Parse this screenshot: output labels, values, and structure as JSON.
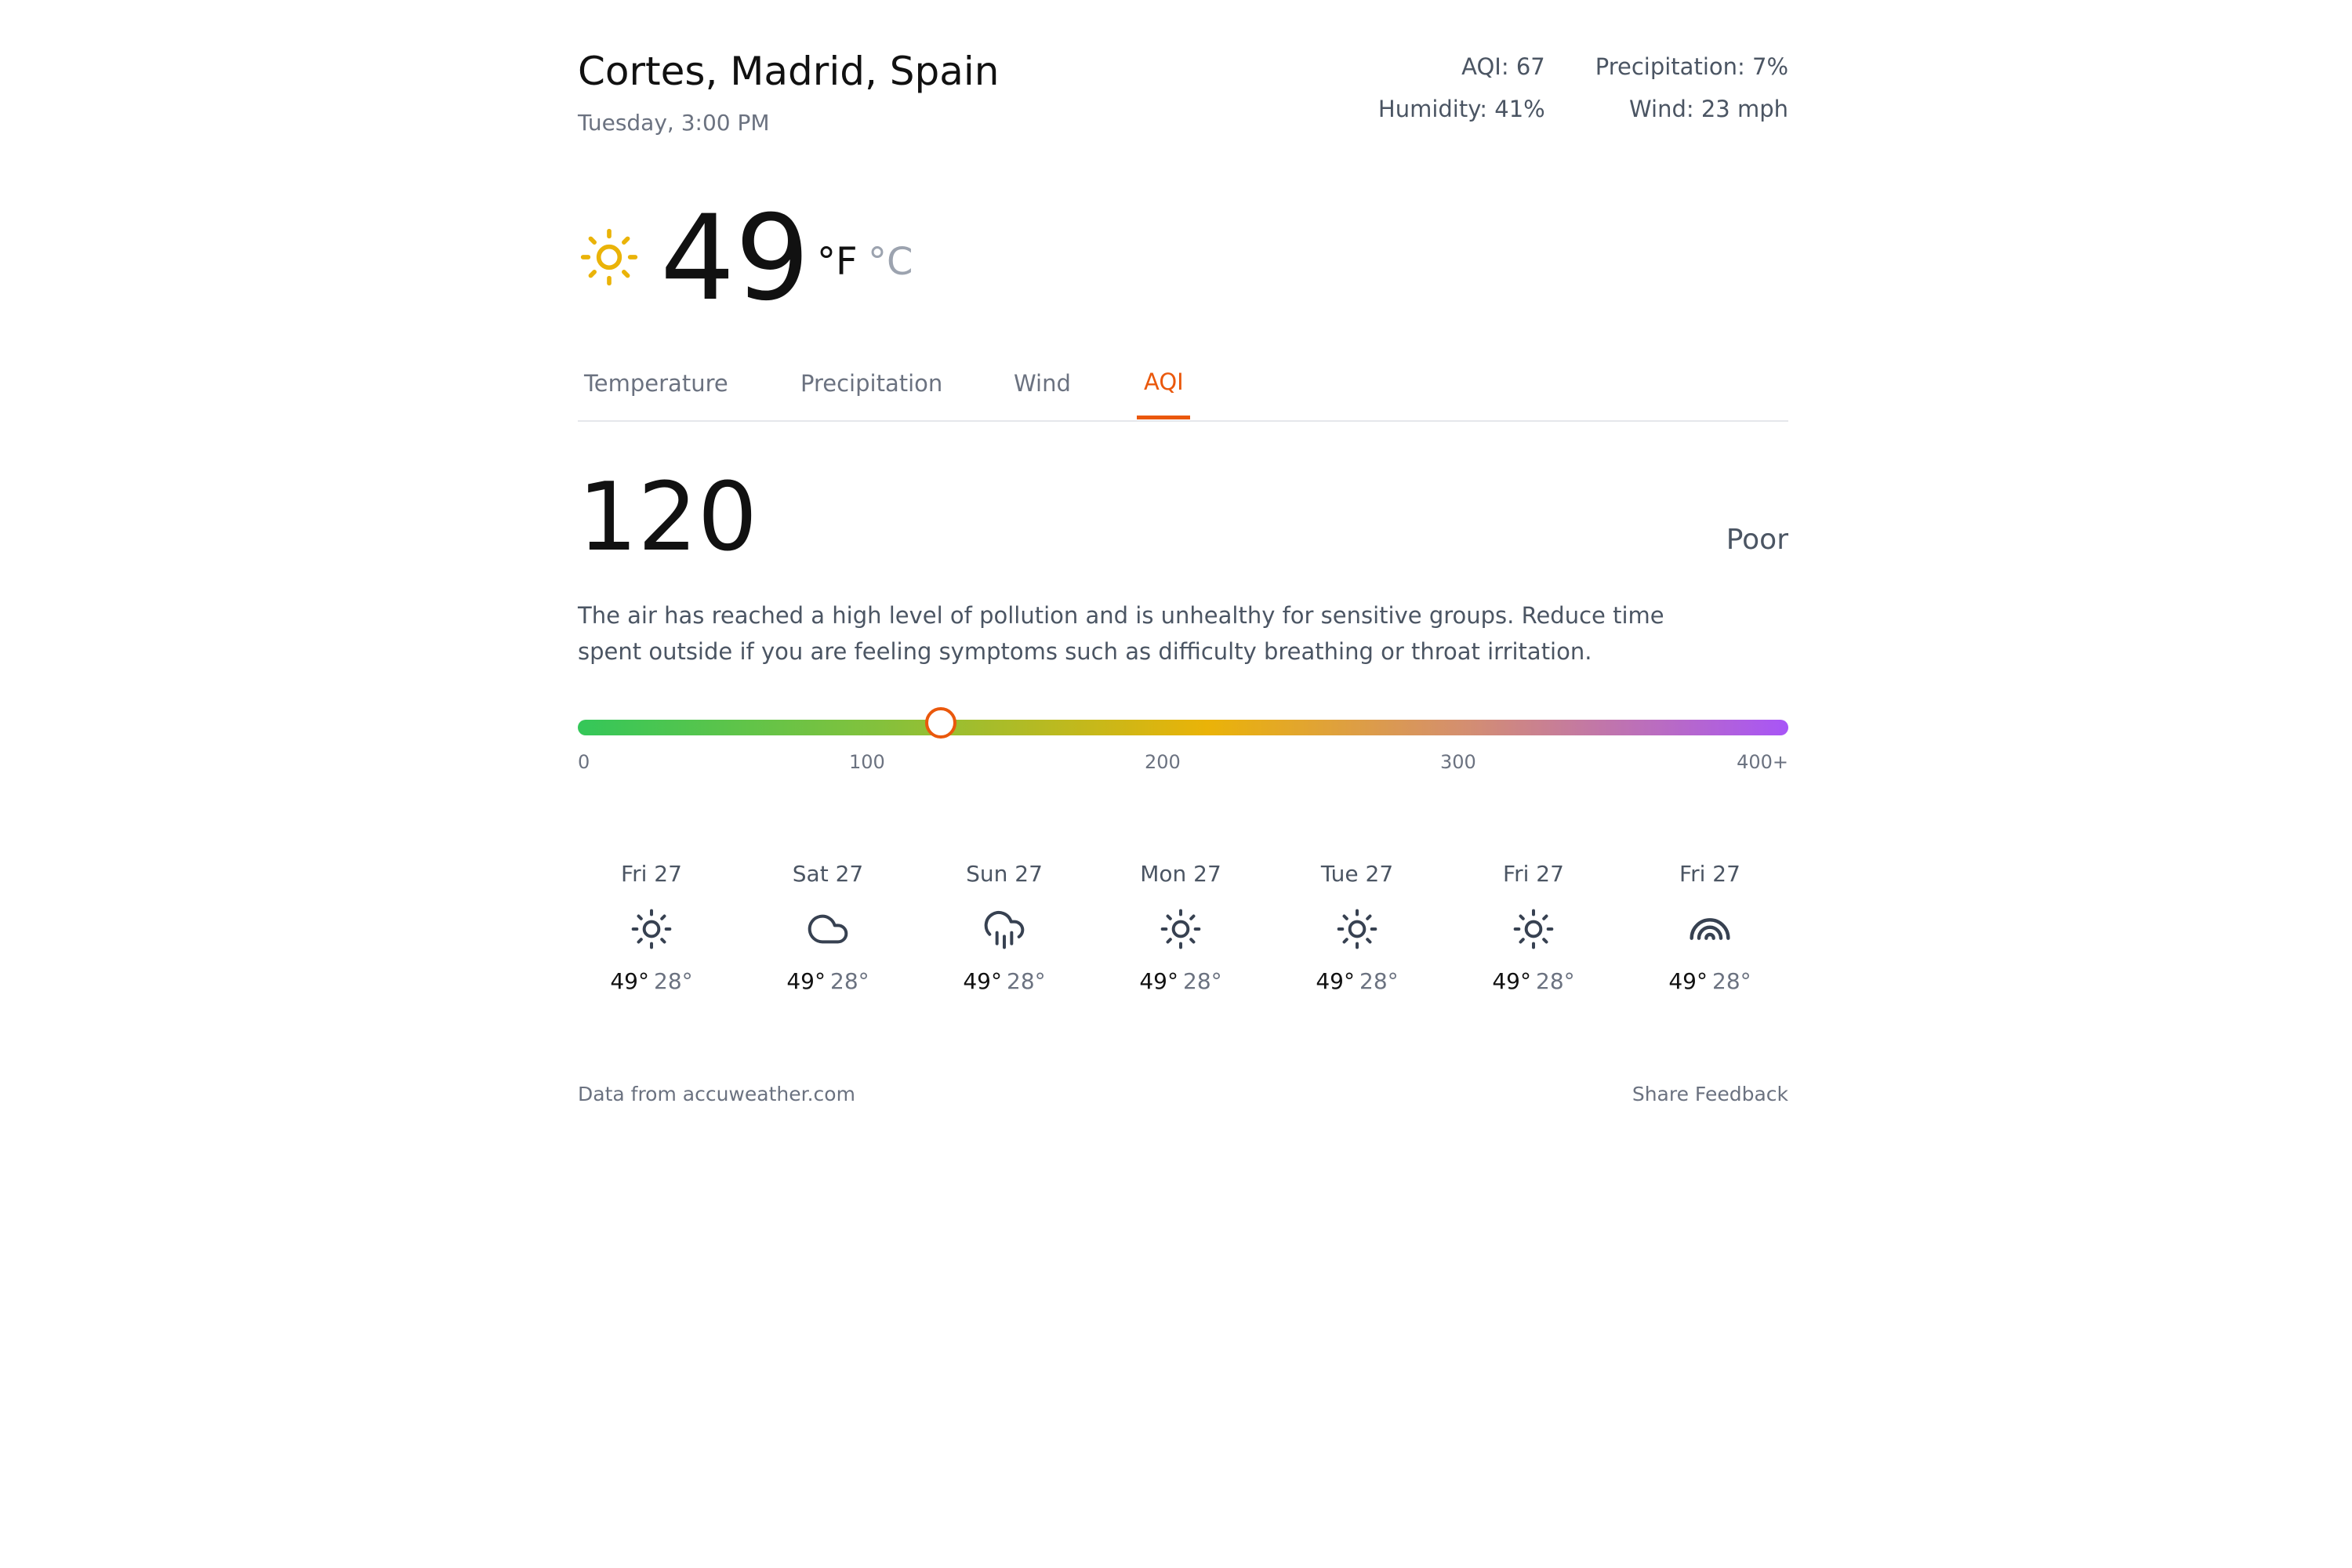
{
  "header": {
    "location": "Cortes, Madrid, Spain",
    "datetime": "Tuesday, 3:00 PM"
  },
  "stats": [
    {
      "label": "AQI: 67"
    },
    {
      "label": "Precipitation: 7%"
    },
    {
      "label": "Humidity: 41%"
    },
    {
      "label": "Wind: 23 mph"
    }
  ],
  "current": {
    "icon": "sun-icon",
    "temperature": "49",
    "unit_f": "°F",
    "unit_c": "°C",
    "active_unit": "F"
  },
  "tabs": [
    {
      "label": "Temperature"
    },
    {
      "label": "Precipitation"
    },
    {
      "label": "Wind"
    },
    {
      "label": "AQI"
    }
  ],
  "active_tab": "AQI",
  "aqi": {
    "value": "120",
    "category": "Poor",
    "description": "The air has reached a high level of pollution and is unhealthy for sensitive groups. Reduce time spent outside if you are feeling symptoms such as difficulty breathing or throat irritation.",
    "scale_ticks": [
      "0",
      "100",
      "200",
      "300",
      "400+"
    ],
    "scale_min": 0,
    "scale_max": 400,
    "scale_colors": [
      "#34c759",
      "#84c13c",
      "#eab308",
      "#d48f6f",
      "#a855f7"
    ]
  },
  "forecast": [
    {
      "day": "Fri 27",
      "icon": "sun-icon",
      "high": "49°",
      "low": "28°"
    },
    {
      "day": "Sat 27",
      "icon": "cloud-icon",
      "high": "49°",
      "low": "28°"
    },
    {
      "day": "Sun 27",
      "icon": "cloud-rain-icon",
      "high": "49°",
      "low": "28°"
    },
    {
      "day": "Mon 27",
      "icon": "sun-icon",
      "high": "49°",
      "low": "28°"
    },
    {
      "day": "Tue 27",
      "icon": "sun-icon",
      "high": "49°",
      "low": "28°"
    },
    {
      "day": "Fri 27",
      "icon": "sun-icon",
      "high": "49°",
      "low": "28°"
    },
    {
      "day": "Fri 27",
      "icon": "rainbow-icon",
      "high": "49°",
      "low": "28°"
    }
  ],
  "footer": {
    "source": "Data from accuweather.com",
    "feedback": "Share Feedback"
  },
  "colors": {
    "accent": "#ea580c",
    "sun": "#eab308",
    "icon": "#374151"
  }
}
